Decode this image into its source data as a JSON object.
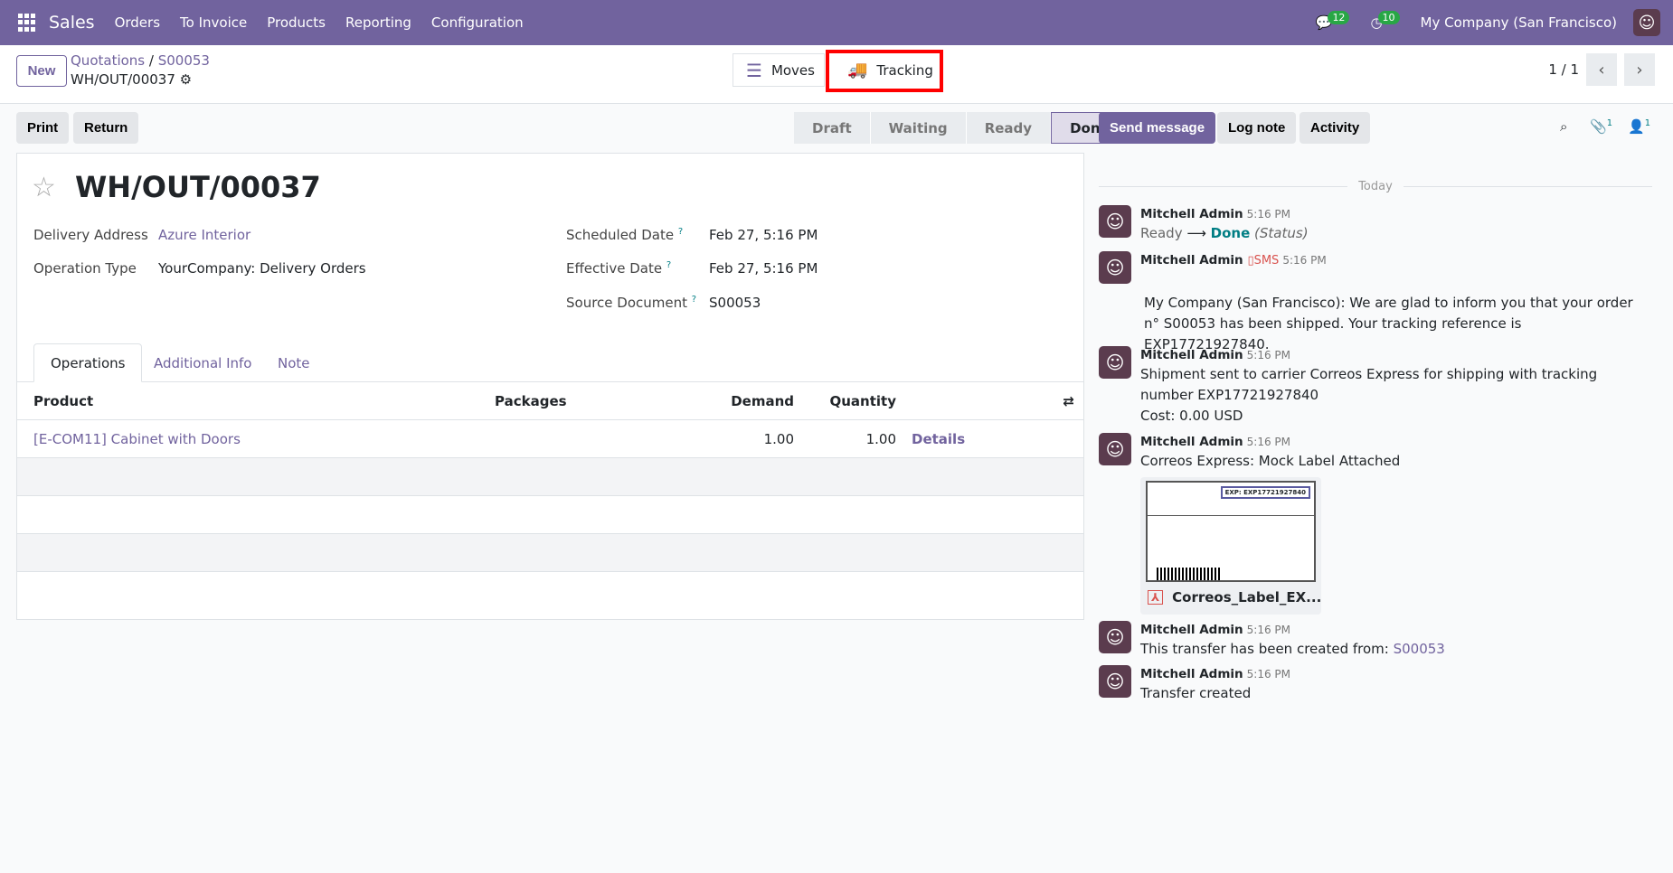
{
  "topbar": {
    "app": "Sales",
    "menu": [
      "Orders",
      "To Invoice",
      "Products",
      "Reporting",
      "Configuration"
    ],
    "messages_count": "12",
    "activities_count": "10",
    "company": "My Company (San Francisco)"
  },
  "control": {
    "new": "New",
    "breadcrumb": [
      "Quotations",
      "S00053"
    ],
    "current": "WH/OUT/00037",
    "moves": "Moves",
    "tracking": "Tracking",
    "pager": "1 / 1"
  },
  "actions": {
    "print": "Print",
    "return": "Return"
  },
  "status": [
    "Draft",
    "Waiting",
    "Ready",
    "Done"
  ],
  "chatter_buttons": {
    "send": "Send message",
    "log": "Log note",
    "activity": "Activity",
    "attachments": "1",
    "followers": "1"
  },
  "form": {
    "title": "WH/OUT/00037",
    "delivery_address_label": "Delivery Address",
    "delivery_address": "Azure Interior",
    "operation_type_label": "Operation Type",
    "operation_type": "YourCompany: Delivery Orders",
    "scheduled_label": "Scheduled Date",
    "scheduled": "Feb 27, 5:16 PM",
    "effective_label": "Effective Date",
    "effective": "Feb 27, 5:16 PM",
    "source_label": "Source Document",
    "source": "S00053",
    "help": "?",
    "tabs": [
      "Operations",
      "Additional Info",
      "Note"
    ],
    "columns": [
      "Product",
      "Packages",
      "Demand",
      "Quantity"
    ],
    "rows": [
      {
        "product": "[E-COM11] Cabinet with Doors",
        "demand": "1.00",
        "quantity": "1.00",
        "details": "Details"
      }
    ]
  },
  "chatter": {
    "today": "Today",
    "messages": [
      {
        "author": "Mitchell Admin",
        "time": "5:16 PM",
        "from": "Ready",
        "to": "Done",
        "field": "(Status)"
      },
      {
        "author": "Mitchell Admin",
        "sms": "SMS",
        "time": "5:16 PM",
        "text": "My Company (San Francisco): We are glad to inform you that your order n° S00053 has been shipped. Your tracking reference is EXP17721927840."
      },
      {
        "author": "Mitchell Admin",
        "time": "5:16 PM",
        "text": "Shipment sent to carrier Correos Express for shipping with tracking number EXP17721927840",
        "cost": "Cost: 0.00 USD"
      },
      {
        "author": "Mitchell Admin",
        "time": "5:16 PM",
        "text": "Correos Express: Mock Label Attached",
        "attachment": "Correos_Label_EX...",
        "label_ref": "EXP: EXP17721927840"
      },
      {
        "author": "Mitchell Admin",
        "time": "5:16 PM",
        "text": "This transfer has been created from: ",
        "link": "S00053"
      },
      {
        "author": "Mitchell Admin",
        "time": "5:16 PM",
        "text": "Transfer created"
      }
    ]
  }
}
